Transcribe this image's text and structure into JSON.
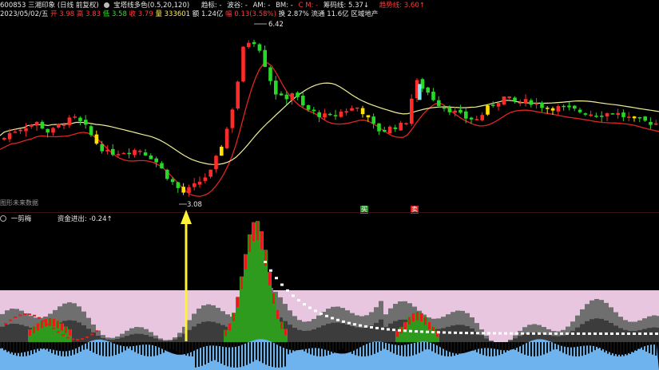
{
  "header": {
    "line1": {
      "security": "600853 三湘印象 (日线 前复权)",
      "indicator_icon": "circle-icon",
      "indicator_name": "宝塔线多色(0.5,20,120)",
      "trend_label": "趋标: -",
      "wave_label": "波谷: -",
      "am_label": "AM: -",
      "bm_label": "BM: -",
      "cm_label": "C M: -",
      "entry_label": "筹码线: 5.37↓",
      "trend_line_label": "趋势线: 3.60↑"
    },
    "line2": {
      "date": "2023/05/02/五",
      "open": "开 3.98",
      "high": "高 3.83",
      "low": "低 3.58",
      "close": "收 3.79",
      "volume": "量 333601",
      "amount": "额 1.24亿",
      "change": "幅 0.13(3.58%)",
      "turnover": "换 2.87%",
      "float_value": "流通 11.6亿",
      "sector": "区域地产"
    }
  },
  "main_chart": {
    "price_high_label": "6.42",
    "price_low_label": "3.08",
    "future_data_label": "图形未来数据",
    "signal_buy": "买",
    "signal_sell": "卖",
    "colors": {
      "up_candle": "#ff2a2a",
      "down_candle": "#27d827",
      "yellow_candle": "#ffe000",
      "cyan_candle": "#7fe8ee",
      "ma_short": "#e02424",
      "ma_long": "#f0ef98",
      "highlight_arrow": "#fff23a"
    }
  },
  "indicator_panel": {
    "title": "一剪梅",
    "sub_label": "资金进出: -0.24↑",
    "colors": {
      "zone_pink": "#e9c6e0",
      "mountain_gray": "#6f6f6f",
      "mountain_dark": "#3c3c3c",
      "green": "#2e9b1f",
      "red": "#e81a1a",
      "white_dots": "#ffffff",
      "water_blue": "#6fb3ee"
    }
  }
}
